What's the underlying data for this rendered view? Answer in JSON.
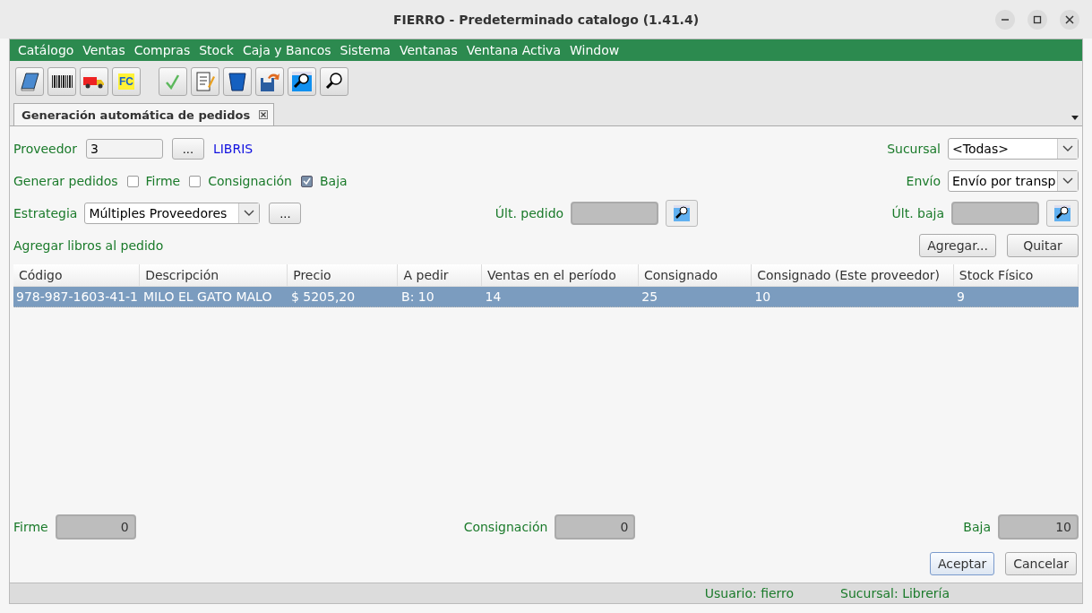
{
  "window": {
    "title": "FIERRO - Predeterminado catalogo (1.41.4)"
  },
  "menu": [
    "Catálogo",
    "Ventas",
    "Compras",
    "Stock",
    "Caja y Bancos",
    "Sistema",
    "Ventanas",
    "Ventana Activa",
    "Window"
  ],
  "toolbar": [
    {
      "kind": "book"
    },
    {
      "kind": "barcode"
    },
    {
      "kind": "truck"
    },
    {
      "kind": "fc",
      "label": "FC"
    },
    {
      "kind": "check"
    },
    {
      "kind": "notepad"
    },
    {
      "kind": "bin"
    },
    {
      "kind": "disk"
    },
    {
      "kind": "magnifier-window"
    },
    {
      "kind": "magnifier"
    }
  ],
  "tabs": [
    {
      "label": "Generación automática de pedidos",
      "selected": true
    }
  ],
  "form": {
    "proveedor": {
      "label": "Proveedor",
      "value": "3",
      "button": "...",
      "name": "LIBRIS"
    },
    "sucursal": {
      "label": "Sucursal",
      "value": "<Todas>"
    },
    "generar": {
      "label": "Generar pedidos",
      "options": [
        {
          "label": "Firme",
          "checked": false
        },
        {
          "label": "Consignación",
          "checked": false
        },
        {
          "label": "Baja",
          "checked": true
        }
      ]
    },
    "envio": {
      "label": "Envío",
      "value": "Envío por transp"
    },
    "estrategia": {
      "label": "Estrategia",
      "value": "Múltiples Proveedores",
      "button": "..."
    },
    "ult_pedido": {
      "label": "Últ. pedido"
    },
    "ult_baja": {
      "label": "Últ. baja"
    },
    "agregar_label": "Agregar libros al pedido",
    "add_button": "Agregar...",
    "remove_button": "Quitar"
  },
  "table": {
    "columns": [
      "Código",
      "Descripción",
      "Precio",
      "A pedir",
      "Ventas en el período",
      "Consignado",
      "Consignado (Este proveedor)",
      "Stock Físico"
    ],
    "rows": [
      {
        "cells": [
          "978-987-1603-41-1",
          "MILO EL GATO MALO",
          "$ 5205,20",
          "B: 10",
          "14",
          "25",
          "10",
          "9"
        ],
        "selected": true
      }
    ]
  },
  "totals": [
    {
      "label": "Firme",
      "value": "0"
    },
    {
      "label": "Consignación",
      "value": "0"
    },
    {
      "label": "Baja",
      "value": "10"
    }
  ],
  "buttons": [
    {
      "label": "Aceptar",
      "default": true
    },
    {
      "label": "Cancelar",
      "default": false
    }
  ],
  "status_bar": [
    "Usuario: fierro",
    "Sucursal: Librería"
  ]
}
